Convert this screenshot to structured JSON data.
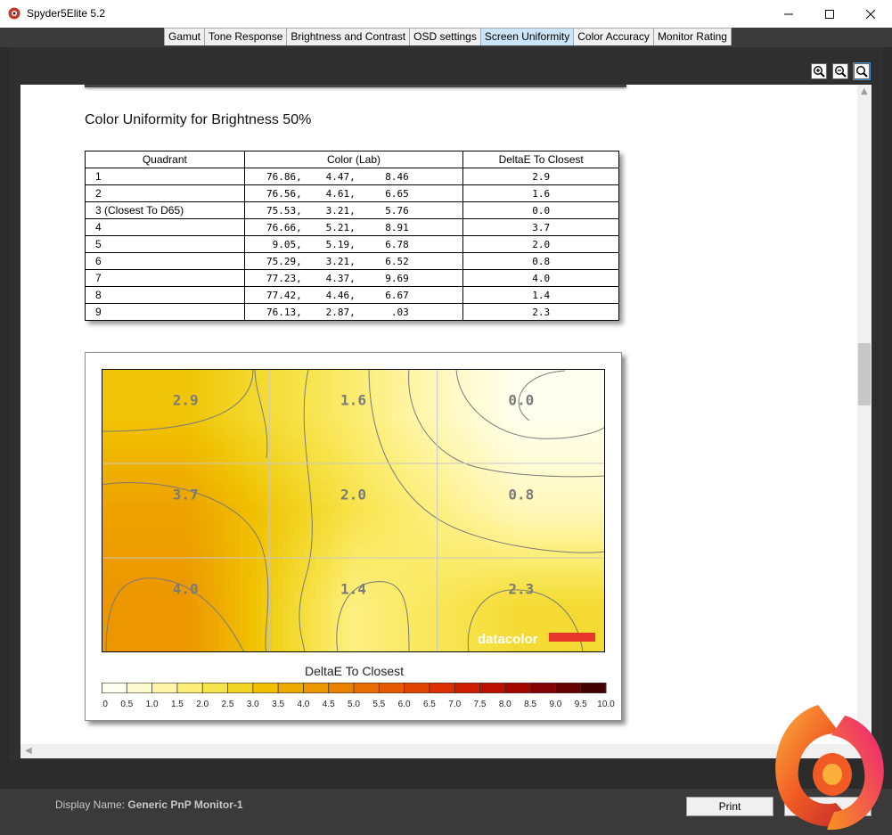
{
  "window": {
    "title": "Spyder5Elite 5.2"
  },
  "tabs": [
    {
      "label": "Gamut"
    },
    {
      "label": "Tone Response"
    },
    {
      "label": "Brightness and Contrast"
    },
    {
      "label": "OSD settings"
    },
    {
      "label": "Screen Uniformity",
      "active": true
    },
    {
      "label": "Color Accuracy"
    },
    {
      "label": "Monitor Rating"
    }
  ],
  "report": {
    "section_title": "Color Uniformity for Brightness 50%",
    "table": {
      "headers": [
        "Quadrant",
        "Color (Lab)",
        "DeltaE To Closest"
      ],
      "rows": [
        {
          "quadrant": "1",
          "L": "76.86,",
          "a": "4.47,",
          "b": "8.46",
          "delta": "2.9"
        },
        {
          "quadrant": "2",
          "L": "76.56,",
          "a": "4.61,",
          "b": "6.65",
          "delta": "1.6"
        },
        {
          "quadrant": "3 (Closest To D65)",
          "L": "75.53,",
          "a": "3.21,",
          "b": "5.76",
          "delta": "0.0"
        },
        {
          "quadrant": "4",
          "L": "76.66,",
          "a": "5.21,",
          "b": "8.91",
          "delta": "3.7"
        },
        {
          "quadrant": "5",
          "L": "9.05,",
          "a": "5.19,",
          "b": "6.78",
          "delta": "2.0"
        },
        {
          "quadrant": "6",
          "L": "75.29,",
          "a": "3.21,",
          "b": "6.52",
          "delta": "0.8"
        },
        {
          "quadrant": "7",
          "L": "77.23,",
          "a": "4.37,",
          "b": "9.69",
          "delta": "4.0"
        },
        {
          "quadrant": "8",
          "L": "77.42,",
          "a": "4.46,",
          "b": "6.67",
          "delta": "1.4"
        },
        {
          "quadrant": "9",
          "L": "76.13,",
          "a": "2.87,",
          "b": ".03",
          "delta": "2.3"
        }
      ]
    }
  },
  "chart_data": {
    "type": "heatmap",
    "title": "DeltaE To Closest",
    "grid": {
      "rows": 3,
      "cols": 3
    },
    "cells": [
      {
        "row": 0,
        "col": 0,
        "value": 2.9,
        "label": "2.9"
      },
      {
        "row": 0,
        "col": 1,
        "value": 1.6,
        "label": "1.6"
      },
      {
        "row": 0,
        "col": 2,
        "value": 0.0,
        "label": "0.0"
      },
      {
        "row": 1,
        "col": 0,
        "value": 3.7,
        "label": "3.7"
      },
      {
        "row": 1,
        "col": 1,
        "value": 2.0,
        "label": "2.0"
      },
      {
        "row": 1,
        "col": 2,
        "value": 0.8,
        "label": "0.8"
      },
      {
        "row": 2,
        "col": 0,
        "value": 4.0,
        "label": "4.0"
      },
      {
        "row": 2,
        "col": 1,
        "value": 1.4,
        "label": "1.4"
      },
      {
        "row": 2,
        "col": 2,
        "value": 2.3,
        "label": "2.3"
      }
    ],
    "colorbar": {
      "range": [
        0,
        10
      ],
      "ticks": [
        "0.0",
        "0.5",
        "1.0",
        "1.5",
        "2.0",
        "2.5",
        "3.0",
        "3.5",
        "4.0",
        "4.5",
        "5.0",
        "5.5",
        "6.0",
        "6.5",
        "7.0",
        "7.5",
        "8.0",
        "8.5",
        "9.0",
        "9.5",
        "10.0"
      ],
      "colors": [
        "#fffff0",
        "#fffbd0",
        "#fff5a8",
        "#fcee78",
        "#f7e34a",
        "#f2d422",
        "#f0c000",
        "#eeaa00",
        "#ec9600",
        "#ea8200",
        "#e86e00",
        "#e55a00",
        "#e24500",
        "#dc3000",
        "#d01e00",
        "#be1000",
        "#a40600",
        "#860200",
        "#650000",
        "#420000",
        "#240000"
      ]
    },
    "grid_lines": true,
    "contours": true,
    "watermark": "datacolor",
    "watermark_bar_color": "#e8352b"
  },
  "footer": {
    "display_label": "Display Name:",
    "display_value": "Generic PnP Monitor-1",
    "print_label": "Print"
  }
}
